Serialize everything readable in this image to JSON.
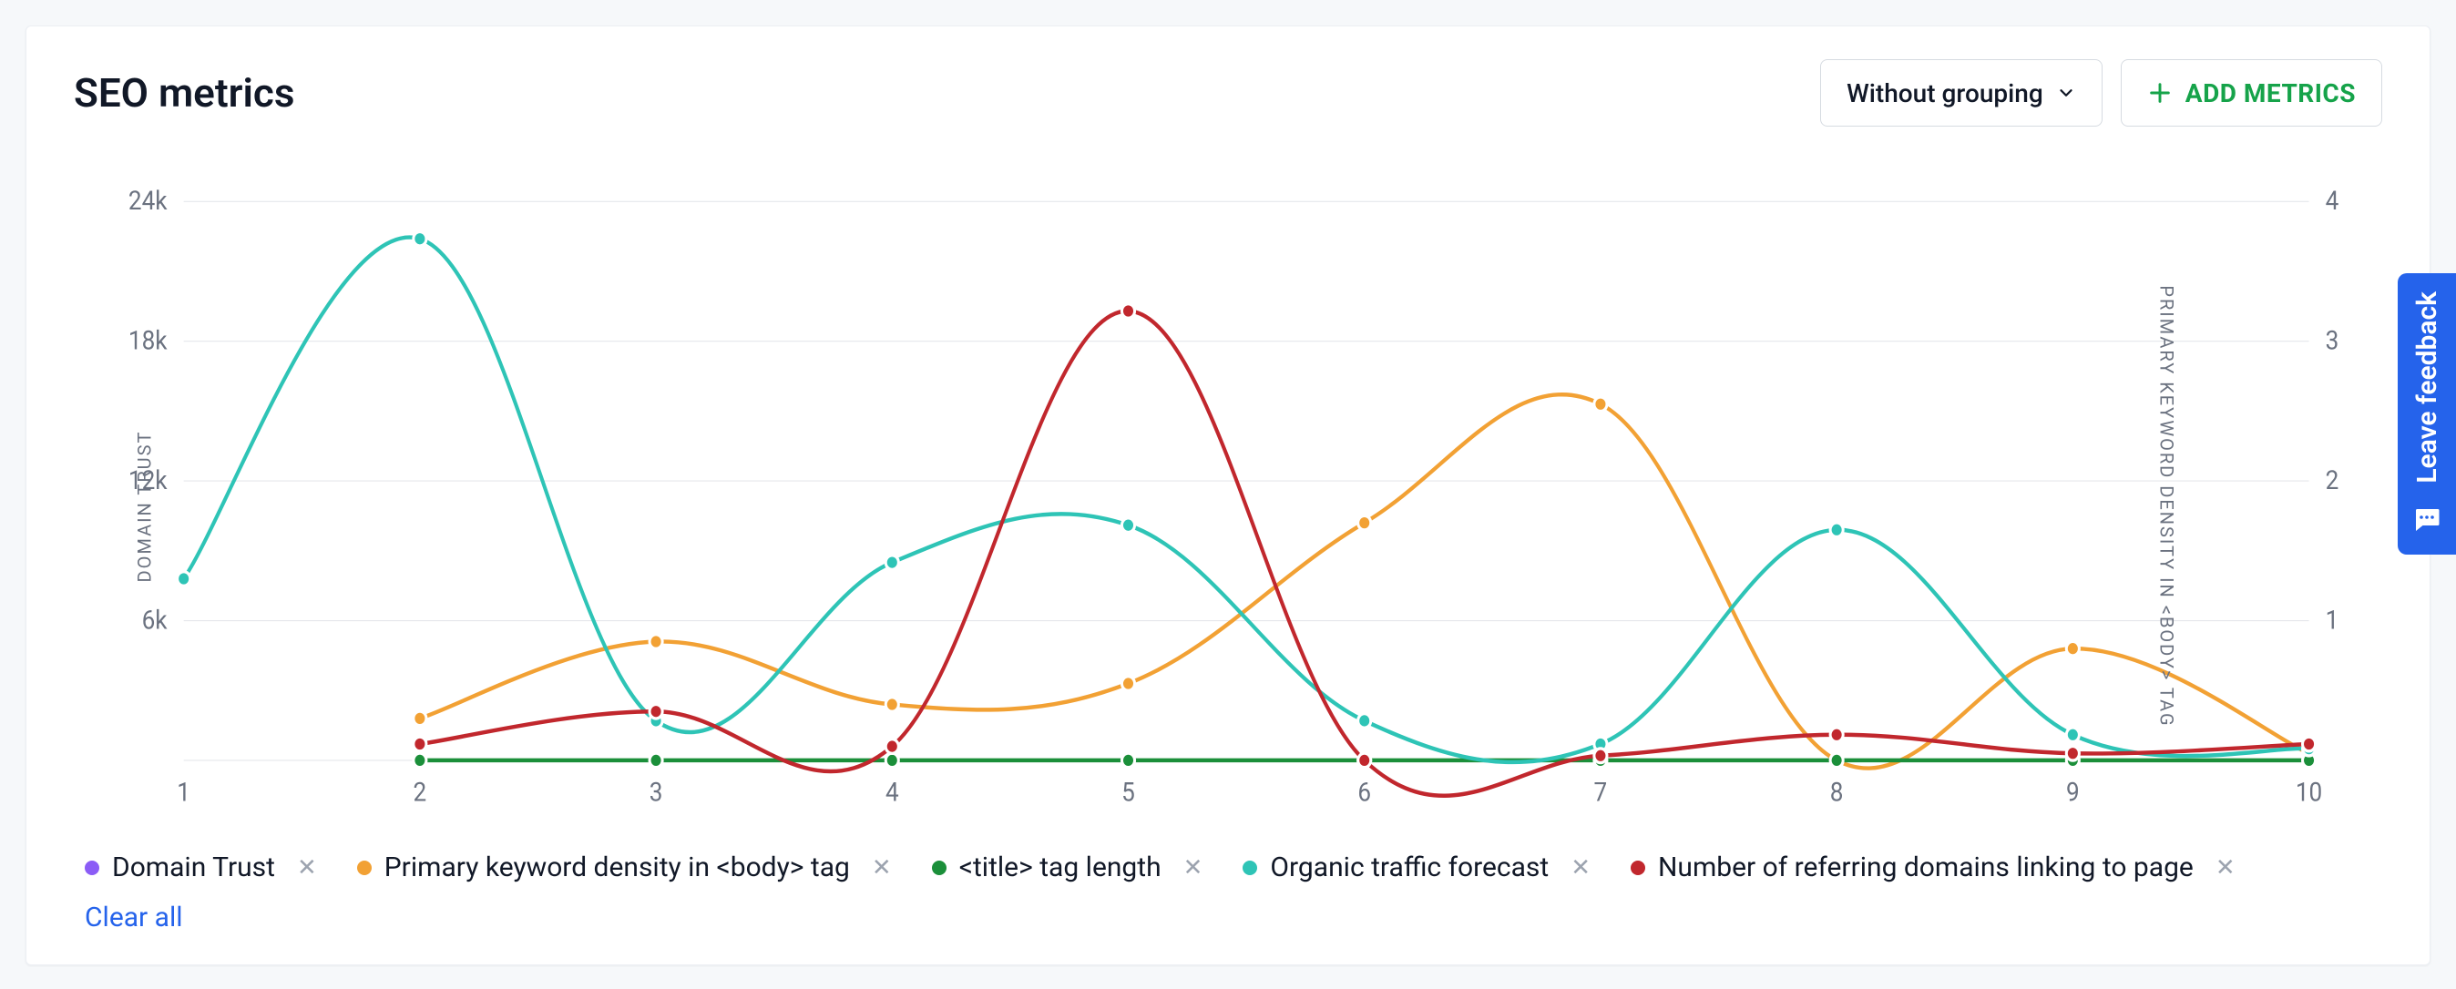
{
  "header": {
    "title": "SEO metrics",
    "grouping_label": "Without grouping",
    "add_metrics_label": "ADD METRICS"
  },
  "axes": {
    "y_label": "DOMAIN TRUST",
    "y2_label": "PRIMARY KEYWORD DENSITY IN <BODY> TAG"
  },
  "legend": {
    "domain_trust": "Domain Trust",
    "keyword_density": "Primary keyword density in <body> tag",
    "title_length": "<title> tag length",
    "organic_traffic": "Organic traffic forecast",
    "referring_domains": "Number of referring domains linking to page",
    "clear_all": "Clear all"
  },
  "feedback": {
    "label": "Leave feedback"
  },
  "colors": {
    "domain_trust": "#8b5cf6",
    "keyword_density": "#f2a134",
    "title_length": "#1b8f3a",
    "organic_traffic": "#2ec4b6",
    "referring_domains": "#c1272d"
  },
  "chart_data": {
    "type": "line",
    "categories": [
      "1",
      "2",
      "3",
      "4",
      "5",
      "6",
      "7",
      "8",
      "9",
      "10"
    ],
    "xlabel": "",
    "y_axis": {
      "label": "DOMAIN TRUST",
      "ticks": [
        0,
        6000,
        12000,
        18000,
        24000
      ],
      "tick_labels": [
        "",
        "6k",
        "12k",
        "18k",
        "24k"
      ],
      "ylim": [
        0,
        24000
      ]
    },
    "y2_axis": {
      "label": "PRIMARY KEYWORD DENSITY IN <BODY> TAG",
      "ticks": [
        0,
        1,
        2,
        3,
        4
      ],
      "ylim": [
        0,
        4
      ]
    },
    "grid": true,
    "legend_position": "bottom",
    "series": [
      {
        "name": "Domain Trust",
        "axis": "y",
        "color": "#8b5cf6",
        "values": [
          null,
          null,
          null,
          null,
          null,
          null,
          null,
          null,
          null,
          null
        ]
      },
      {
        "name": "Primary keyword density in <body> tag",
        "axis": "y2",
        "color": "#f2a134",
        "values": [
          null,
          0.3,
          0.85,
          0.4,
          0.55,
          1.7,
          2.55,
          0.0,
          0.8,
          0.05
        ]
      },
      {
        "name": "<title> tag length",
        "axis": "y",
        "color": "#1b8f3a",
        "values": [
          null,
          0,
          0,
          0,
          0,
          0,
          0,
          0,
          0,
          0
        ]
      },
      {
        "name": "Organic traffic forecast",
        "axis": "y",
        "color": "#2ec4b6",
        "values": [
          7800,
          22400,
          1700,
          8500,
          10100,
          1700,
          700,
          9900,
          1100,
          500
        ]
      },
      {
        "name": "Number of referring domains linking to page",
        "axis": "y",
        "color": "#c1272d",
        "values": [
          null,
          700,
          2100,
          600,
          19300,
          0,
          200,
          1100,
          300,
          700
        ]
      }
    ]
  }
}
